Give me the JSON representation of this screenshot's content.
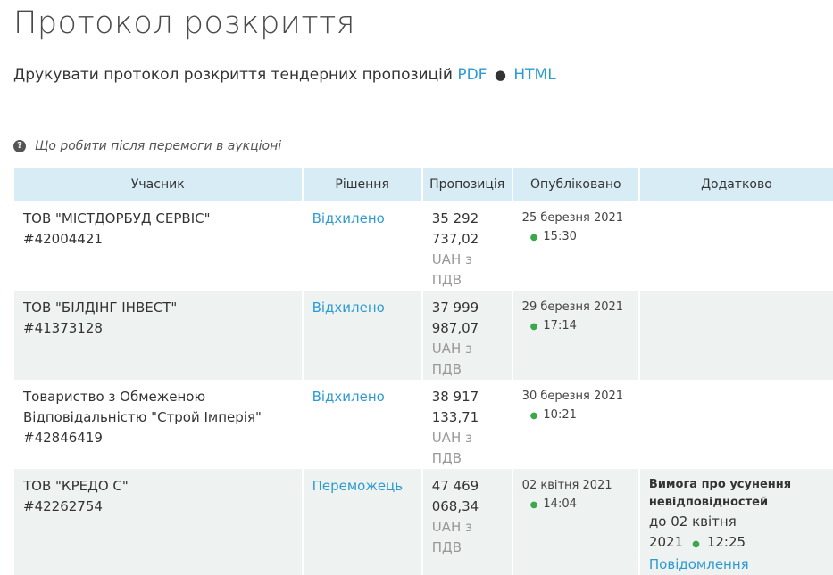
{
  "page": {
    "title": "Протокол розкриття",
    "print_text": "Друкувати протокол розкриття тендерних пропозицій",
    "print_pdf": "PDF",
    "print_separator": "●",
    "print_html": "HTML",
    "help_text": "Що робити після перемоги в аукціоні"
  },
  "table": {
    "headers": {
      "participant": "Учасник",
      "decision": "Рішення",
      "offer": "Пропозиція",
      "published": "Опубліковано",
      "extra": "Додатково"
    },
    "rows": [
      {
        "participant": "ТОВ \"МІСТДОРБУД СЕРВІС\"",
        "code": "#42004421",
        "decision": "Відхилено",
        "amount_1": "35 292",
        "amount_2": "737,02",
        "currency": "UAH з ПДВ",
        "date": "25 березня 2021",
        "time": "15:30"
      },
      {
        "participant": "ТОВ \"БІЛДІНГ ІНВЕСТ\"",
        "code": "#41373128",
        "decision": "Відхилено",
        "amount_1": "37 999",
        "amount_2": "987,07",
        "currency": "UAH з ПДВ",
        "date": "29 березня 2021",
        "time": "17:14"
      },
      {
        "participant_1": "Товариство з Обмеженою",
        "participant_2": "Відповідальністю \"Строй Імперія\"",
        "code": "#42846419",
        "decision": "Відхилено",
        "amount_1": "38 917",
        "amount_2": "133,71",
        "currency": "UAH з ПДВ",
        "date": "30 березня 2021",
        "time": "10:21"
      },
      {
        "participant": "ТОВ \"КРЕДО С\"",
        "code": "#42262754",
        "decision": "Переможець",
        "amount_1": "47 469",
        "amount_2": "068,34",
        "currency": "UAH з ПДВ",
        "date": "02 квітня 2021",
        "time": "14:04",
        "extra_title_1": "Вимога про усунення",
        "extra_title_2": "невідповідностей",
        "extra_deadline": "до 02 квітня 2021",
        "extra_deadline_time": "12:25",
        "extra_link": "Повідомлення"
      }
    ]
  },
  "colors": {
    "link": "#2d9bd2",
    "header_bg": "#d8ecf5",
    "alt_row_bg": "#eef2f1",
    "bullet": "#3aa84b"
  }
}
